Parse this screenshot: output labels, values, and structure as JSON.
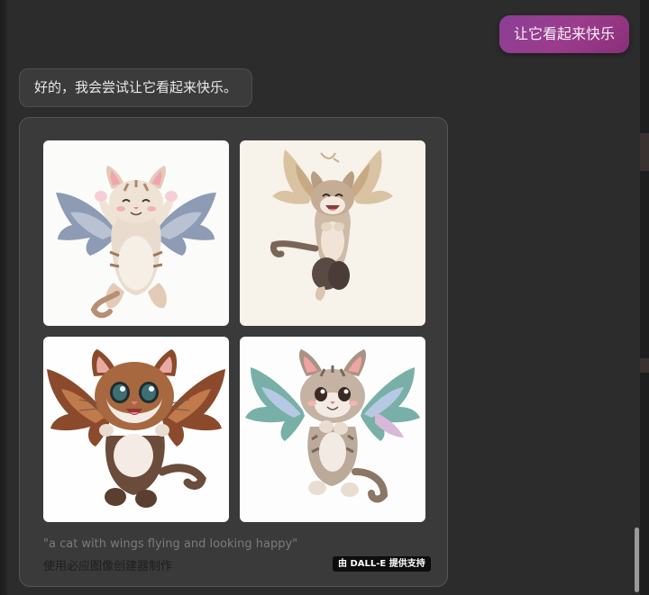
{
  "conversation": {
    "user_message": "让它看起来快乐",
    "assistant_message": "好的，我会尝试让它看起来快乐。"
  },
  "image_result": {
    "prompt": "\"a cat with wings flying and looking happy\"",
    "creator_text": "使用必应图像创建器制作",
    "powered_by": "由 DALL-E 提供支持",
    "images": [
      {
        "icon": "winged-cat-image-1"
      },
      {
        "icon": "winged-cat-image-2"
      },
      {
        "icon": "winged-cat-image-3"
      },
      {
        "icon": "winged-cat-image-4"
      }
    ]
  },
  "colors": {
    "background": "#2c2c2c",
    "user_bubble": "#993d8e",
    "assistant_bubble": "#3b3b3b",
    "card": "#3a3a3a"
  }
}
